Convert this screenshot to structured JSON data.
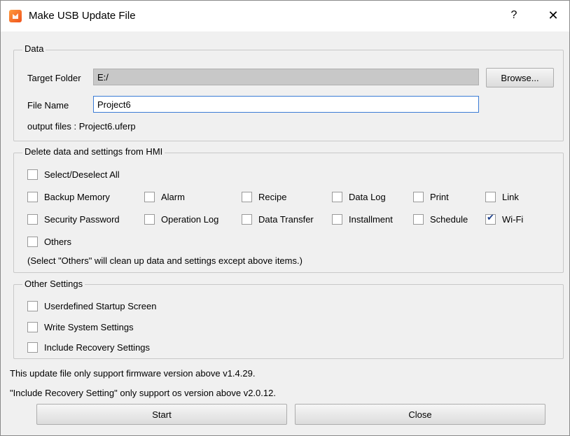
{
  "window": {
    "title": "Make USB Update File",
    "help_label": "?",
    "close_label": "✕"
  },
  "data_group": {
    "title": "Data",
    "target_folder_label": "Target Folder",
    "target_folder_value": "E:/",
    "browse_label": "Browse...",
    "file_name_label": "File Name",
    "file_name_value": "Project6",
    "output_files": "output files : Project6.uferp"
  },
  "delete_group": {
    "title": "Delete data and settings from HMI",
    "select_all_label": "Select/Deselect All",
    "select_all_checked": false,
    "items": [
      {
        "label": "Backup Memory",
        "checked": false
      },
      {
        "label": "Alarm",
        "checked": false
      },
      {
        "label": "Recipe",
        "checked": false
      },
      {
        "label": "Data Log",
        "checked": false
      },
      {
        "label": "Print",
        "checked": false
      },
      {
        "label": "Link",
        "checked": false
      },
      {
        "label": "Security Password",
        "checked": false
      },
      {
        "label": "Operation Log",
        "checked": false
      },
      {
        "label": "Data Transfer",
        "checked": false
      },
      {
        "label": "Installment",
        "checked": false
      },
      {
        "label": "Schedule",
        "checked": false
      },
      {
        "label": "Wi-Fi",
        "checked": true
      }
    ],
    "others_label": "Others",
    "others_checked": false,
    "note": "(Select \"Others\" will clean up data and settings except above items.)"
  },
  "other_settings": {
    "title": "Other Settings",
    "items": [
      {
        "label": "Userdefined Startup Screen",
        "checked": false
      },
      {
        "label": "Write System Settings",
        "checked": false
      },
      {
        "label": "Include Recovery Settings",
        "checked": false
      }
    ]
  },
  "footer": {
    "note1": "This update file only support firmware version above v1.4.29.",
    "note2": "\"Include Recovery Setting\" only support os version above v2.0.12.",
    "start_label": "Start",
    "close_label": "Close"
  }
}
